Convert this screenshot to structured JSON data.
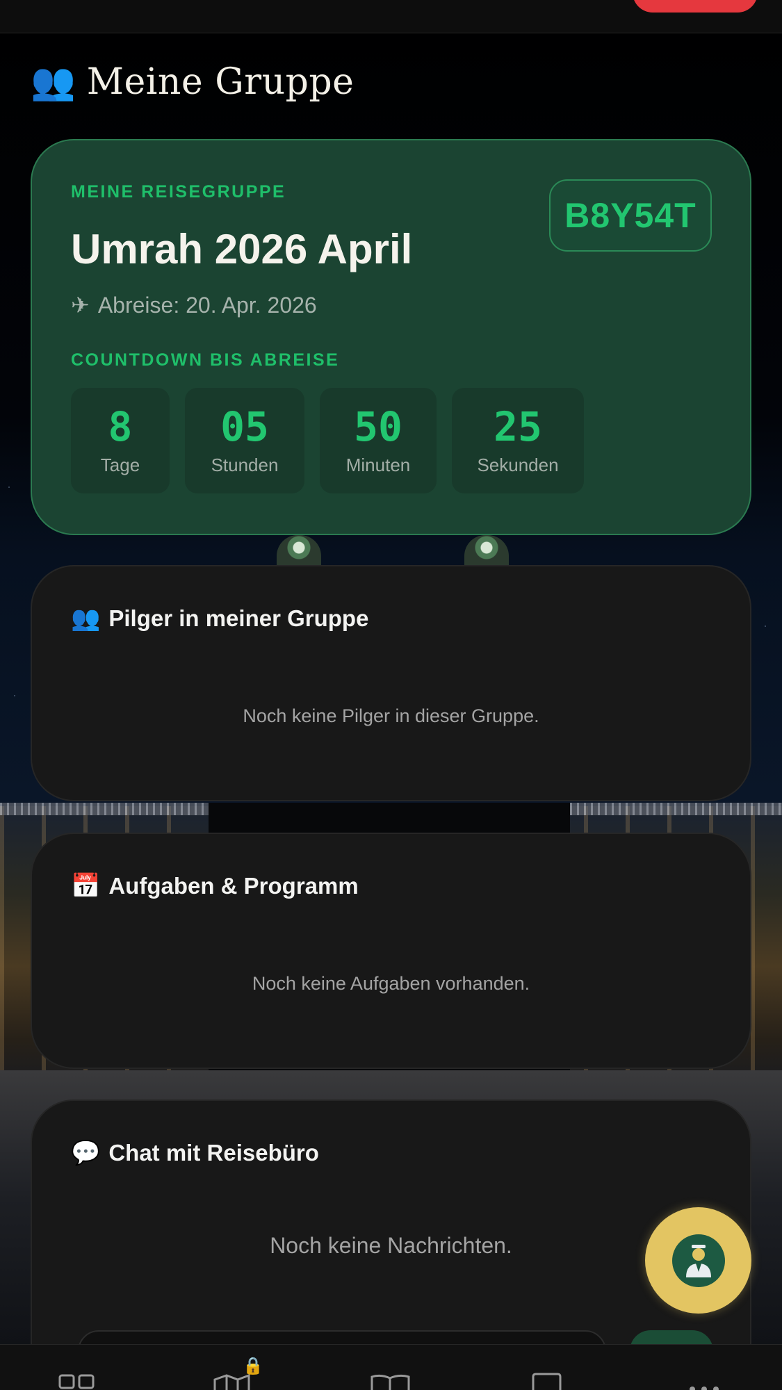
{
  "page": {
    "title": "Meine Gruppe",
    "title_icon": "👥"
  },
  "group": {
    "eyebrow": "MEINE REISEGRUPPE",
    "name": "Umrah 2026 April",
    "departure_icon": "✈",
    "departure": "Abreise: 20. Apr. 2026",
    "code": "B8Y54T",
    "countdown_title": "COUNTDOWN BIS ABREISE",
    "countdown": [
      {
        "value": "8",
        "label": "Tage"
      },
      {
        "value": "05",
        "label": "Stunden"
      },
      {
        "value": "50",
        "label": "Minuten"
      },
      {
        "value": "25",
        "label": "Sekunden"
      }
    ]
  },
  "pilgrims": {
    "icon": "👥",
    "title": "Pilger in meiner Gruppe",
    "empty": "Noch keine Pilger in dieser Gruppe."
  },
  "tasks": {
    "icon": "📅",
    "title": "Aufgaben & Programm",
    "empty": "Noch keine Aufgaben vorhanden."
  },
  "chat": {
    "icon": "💬",
    "title": "Chat mit Reisebüro",
    "empty": "Noch keine Nachrichten."
  },
  "fab": {
    "icon": "guide-person-icon"
  },
  "bottom_nav": {
    "items": [
      "grid-icon",
      "map-icon",
      "book-icon",
      "square-icon",
      "more-icon"
    ],
    "lock_icon": "🔒"
  },
  "colors": {
    "accent_green": "#22c670",
    "hero_card": "#1b4432",
    "card": "#181818",
    "fab_gold": "#e3c562",
    "top_button_red": "#e5383e"
  }
}
